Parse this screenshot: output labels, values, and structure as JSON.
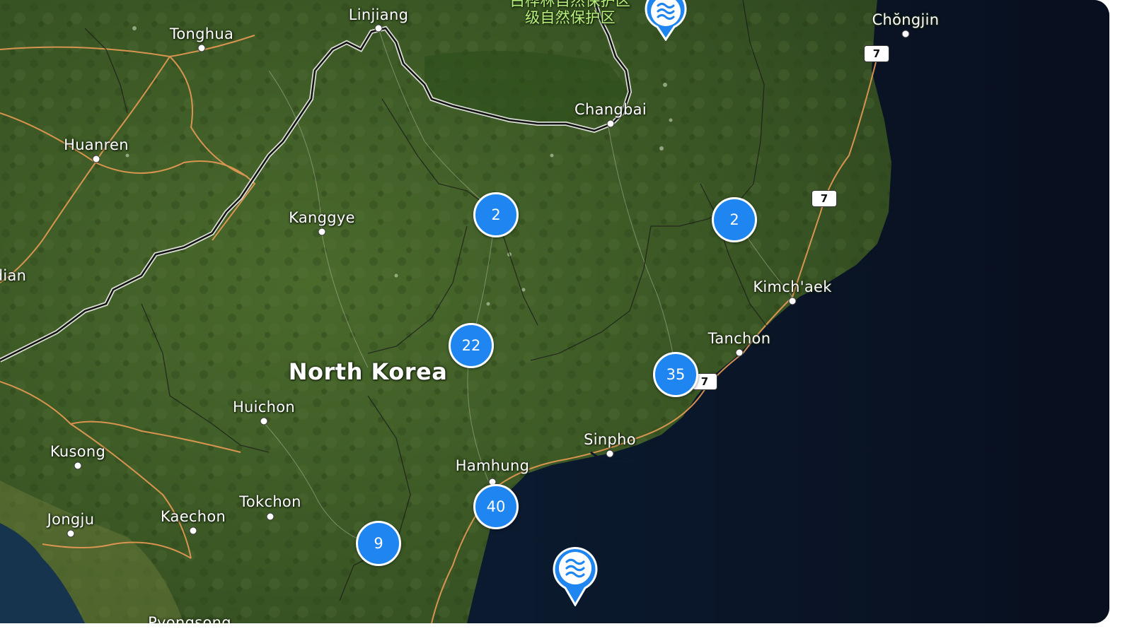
{
  "map": {
    "country_label": "North Korea",
    "chinese_label": [
      "白桦林自然保护区",
      "级自然保护区"
    ],
    "places": [
      {
        "id": "linjiang",
        "name": "Linjiang"
      },
      {
        "id": "tonghua",
        "name": "Tonghua"
      },
      {
        "id": "changbai",
        "name": "Changbai"
      },
      {
        "id": "chongjin",
        "name": "Chŏngjin"
      },
      {
        "id": "huanren",
        "name": "Huanren"
      },
      {
        "id": "kanggye",
        "name": "Kanggye"
      },
      {
        "id": "dian",
        "name": "dian"
      },
      {
        "id": "kimchaek",
        "name": "Kimch'aek"
      },
      {
        "id": "tanchon",
        "name": "Tanchon"
      },
      {
        "id": "huichon",
        "name": "Huichon"
      },
      {
        "id": "kusong",
        "name": "Kusong"
      },
      {
        "id": "sinpho",
        "name": "Sinpho"
      },
      {
        "id": "hamhung",
        "name": "Hamhung"
      },
      {
        "id": "tokchon",
        "name": "Tokchon"
      },
      {
        "id": "kaechon",
        "name": "Kaechon"
      },
      {
        "id": "jongju",
        "name": "Jongju"
      },
      {
        "id": "pyongsong",
        "name": "Pyongsong"
      }
    ],
    "clusters": [
      {
        "id": "c1",
        "count": "2"
      },
      {
        "id": "c2",
        "count": "2"
      },
      {
        "id": "c3",
        "count": "22"
      },
      {
        "id": "c4",
        "count": "35"
      },
      {
        "id": "c5",
        "count": "40"
      },
      {
        "id": "c6",
        "count": "9"
      }
    ],
    "road_shields": [
      "7",
      "7",
      "7"
    ],
    "water_pins": [
      {
        "id": "p1",
        "icon": "water-waves-icon"
      },
      {
        "id": "p2",
        "icon": "water-waves-icon"
      }
    ],
    "colors": {
      "cluster": "#1f85f0",
      "land": "#3d5a25",
      "sea": "#0b1a2e",
      "road": "#e8a15a",
      "border": "#111111"
    }
  }
}
